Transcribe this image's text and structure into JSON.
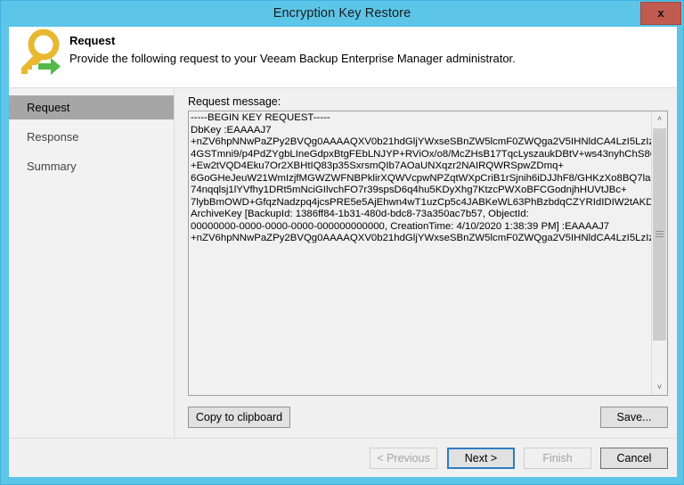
{
  "window": {
    "title": "Encryption Key Restore",
    "close_label": "x"
  },
  "header": {
    "icon": "key-restore-icon",
    "title": "Request",
    "subtitle": "Provide the following request to your Veeam Backup Enterprise Manager administrator."
  },
  "sidebar": {
    "items": [
      {
        "label": "Request",
        "selected": true
      },
      {
        "label": "Response",
        "selected": false
      },
      {
        "label": "Summary",
        "selected": false
      }
    ]
  },
  "main": {
    "field_label": "Request message:",
    "request_message": "-----BEGIN KEY REQUEST-----\nDbKey :EAAAAJ7\n+nZV6hpNNwPaZPy2BVQg0AAAAQXV0b21hdGljYWxseSBnZW5lcmF0ZWQga2V5IHNldCA4LzI5LzIzIwMTkgMzoxMToxNiBBBTRAAAADgNpTXNrE0/6WNsihtyyL0FgIAAAAAAAAAAAAAAAAAgAAAAAAAAAADjqBa27F4Ce5JCAvHcovhZRpZgzGIq1RnBuvETqU2SM4aiYgqK879cVq9ybJEx5979vffCLTpMLxsv+\n4GSTmni9/p4PdZYgbLIneGdpxBtgFEbLNJYP+RViOx/o8/McZHsB17TqcLyszaukDBtV+ws43nyhChS8Q35je2hJDv8X8jxqadSmsSOmpGtrTzC2h6/DBpzktLAH0FnOFnC3GyoOVOOnd6RWO/bOL1zPoA9UNYAb9EsqACF30Rtl3YZ+JSkVvyLTON1hVInpc1XK7aRPUS8AnKO0CF6doCuc2OKFmkQPMiNdCCwXk96ZYNnJRCwppb4S9EhKEAsRo1m/j2XW3\n+Ew2tVQD4Eku7Or2XBHtIQ83p35SxrsmQIb7AOaUNXqzr2NAIRQWRSpwZDmq+\n6GoGHeJeuW21WmIzjfMGWZWFNBPklirXQWVcpwNPZqtWXpCriB1rSjnih6iDJJhF8/GHKzXo8BQ7laZy5IE0pM36fShcWm7RNDp9Xe01i4BnwqYZ+\n74nqqlsj1lYVfhy1DRt5mNciGIlvchFO7r39spsD6q4hu5KDyXhg7KtzcPWXoBFCGodnjhHUVtJBc+\n7lybBmOWD+GfqzNadzpq4jcsPRE5e5AjEhwn4wT1uzCp5c4JABKeWL63PhBzbdqCZYRIdIDIW2tAKDTv9NW6/pNQ==\nArchiveKey [BackupId: 1386ff84-1b31-480d-bdc8-73a350ac7b57, ObjectId:\n00000000-0000-0000-0000-000000000000, CreationTime: 4/10/2020 1:38:39 PM] :EAAAAJ7\n+nZV6hpNNwPaZPy2BVQg0AAAAQXV0b21hdGljYWxseSBnZW5lcmF0ZWQga2V5IHNldCA4LzI5LzIzIwMTkgMzoxMToxNiBBBTRAAAAB1v7L/KV5C22WuyaJho/URFgIAAAAAAAAAAAAAAAAAgAAAAAAAAAAADJ0zHfcqxanG+hW9gUWSOAdgkhIdH3CCZFQsG+OMIVHDt3daGIcydqknsh1XtaADOz",
    "copy_label": "Copy to clipboard",
    "save_label": "Save..."
  },
  "footer": {
    "previous_label": "< Previous",
    "next_label": "Next >",
    "finish_label": "Finish",
    "cancel_label": "Cancel"
  },
  "scrollbar": {
    "up_arrow": "˄",
    "down_arrow": "˅"
  },
  "colors": {
    "title_bar": "#5cc5e8",
    "close_button": "#c15b52",
    "selection": "#a6a6a6",
    "default_button_border": "#2e7dc2",
    "key_gold": "#e8b830",
    "arrow_green": "#4caf50"
  }
}
